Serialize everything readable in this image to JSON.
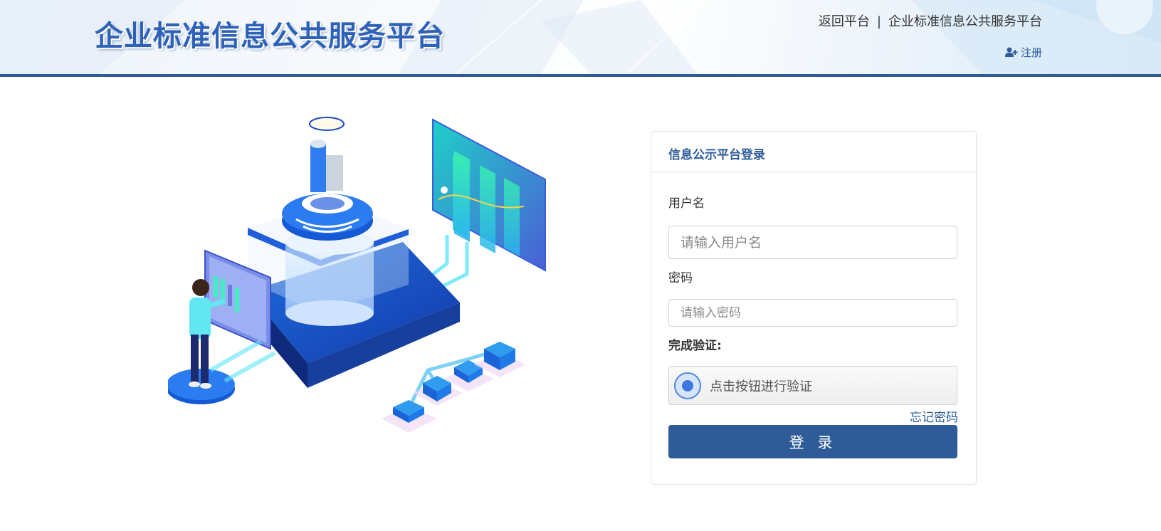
{
  "header": {
    "site_title": "企业标准信息公共服务平台",
    "links": {
      "back": "返回平台",
      "separator": "|",
      "platform": "企业标准信息公共服务平台"
    },
    "register_label": "注册",
    "register_icon": "user-plus-icon"
  },
  "login": {
    "title": "信息公示平台登录",
    "username_label": "用户名",
    "username_placeholder": "请输入用户名",
    "password_label": "密码",
    "password_placeholder": "请输入密码",
    "verify_label": "完成验证:",
    "verify_button_text": "点击按钮进行验证",
    "forgot_password": "忘记密码",
    "submit_label": "登 录"
  },
  "colors": {
    "brand": "#2f5c99",
    "title_blue": "#2e62b8",
    "verify_accent": "#3f78dc"
  }
}
